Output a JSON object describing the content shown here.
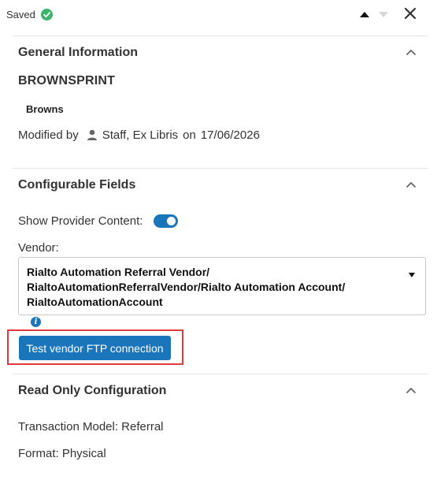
{
  "header": {
    "saved_label": "Saved",
    "icons": {
      "saved": "check-circle-icon",
      "prev": "caret-up-icon",
      "next": "caret-down-icon",
      "close": "close-icon"
    }
  },
  "general": {
    "title": "General Information",
    "record_name": "BROWNSPRINT",
    "record_subtitle": "Browns",
    "modified_by_label": "Modified by",
    "modified_by_user": "Staff, Ex Libris",
    "on_label": "on",
    "modified_date": "17/06/2026"
  },
  "configurable": {
    "title": "Configurable Fields",
    "show_provider_label": "Show Provider Content:",
    "show_provider_value": true,
    "vendor_label": "Vendor:",
    "vendor_value": "Rialto Automation Referral Vendor/ RialtoAutomationReferralVendor/Rialto Automation Account/ RialtoAutomationAccount",
    "test_button_label": "Test vendor FTP connection"
  },
  "readonly": {
    "title": "Read Only Configuration",
    "transaction_model": "Transaction Model: Referral",
    "format": "Format: Physical"
  },
  "colors": {
    "accent": "#1b75bb",
    "success": "#3db36b",
    "highlight_border": "#e0393f"
  }
}
